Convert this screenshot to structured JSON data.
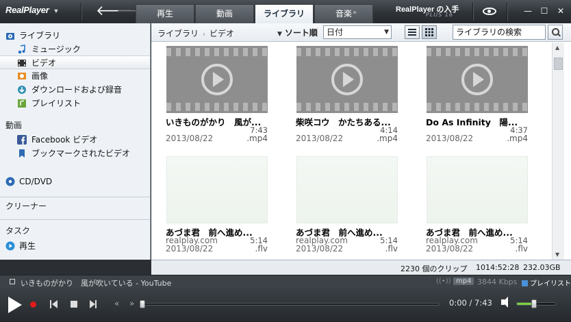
{
  "app": {
    "logo": "RealPlayer",
    "brand": "RealPlayer の入手",
    "brand_sub": "PLUS 16"
  },
  "tabs": [
    {
      "label": "再生"
    },
    {
      "label": "動画"
    },
    {
      "label": "ライブラリ",
      "active": true
    },
    {
      "label": "音楽"
    }
  ],
  "tab_more": "»",
  "sidebar": {
    "library": "ライブラリ",
    "items": [
      {
        "label": "ミュージック"
      },
      {
        "label": "ビデオ",
        "selected": true
      },
      {
        "label": "画像"
      },
      {
        "label": "ダウンロードおよび録音"
      },
      {
        "label": "プレイリスト"
      }
    ],
    "video_head": "動画",
    "video_items": [
      {
        "label": "Facebook ビデオ"
      },
      {
        "label": "ブックマークされたビデオ"
      }
    ],
    "cd_dvd": "CD/DVD",
    "cleaner": "クリーナー",
    "tasks_head": "タスク",
    "tasks": [
      {
        "label": "再生"
      }
    ]
  },
  "toolbar": {
    "breadcrumb_root": "ライブラリ",
    "breadcrumb_current": "ビデオ",
    "sort_label": "ソート順",
    "sort_value": "日付",
    "search_placeholder": "ライブラリの検索"
  },
  "cards": [
    {
      "title": "いきものがかり　風が...",
      "duration": "7:43",
      "date": "2013/08/22",
      "ext": ".mp4",
      "thumb": "video-placeholder"
    },
    {
      "title": "柴咲コウ　かたちある...",
      "duration": "4:14",
      "date": "2013/08/22",
      "ext": ".mp4",
      "thumb": "video-placeholder"
    },
    {
      "title": "Do As Infinity　陽...",
      "duration": "4:37",
      "date": "2013/08/22",
      "ext": ".mp4",
      "thumb": "video-placeholder"
    },
    {
      "title": "あづま君　前へ進め...",
      "source": "realplay.com",
      "duration": "5:14",
      "date": "2013/08/22",
      "ext": ".flv",
      "thumb": "blank"
    },
    {
      "title": "あづま君　前へ進め...",
      "source": "realplay.com",
      "duration": "5:14",
      "date": "2013/08/22",
      "ext": ".flv",
      "thumb": "blank"
    },
    {
      "title": "あづま君　前へ進め...",
      "source": "realplay.com",
      "duration": "5:14",
      "date": "2013/08/22",
      "ext": ".flv",
      "thumb": "blank"
    }
  ],
  "status": {
    "clips": "2230 個のクリップ",
    "total_time": "1014:52:28",
    "size": "232.03GB"
  },
  "now_playing": {
    "title": "いきものがかり　風が吹いている - YouTube",
    "signal": "((•))",
    "format": "mp4",
    "bitrate": "3844 Kbps",
    "playlist_label": "プレイリスト"
  },
  "transport": {
    "time": "0:00 / 7:43",
    "progress_fraction": 0.0,
    "volume_fraction": 0.45
  },
  "colors": {
    "accent_tab": "#ffffff",
    "record": "#e21b1b",
    "volume": "#7bd23b"
  }
}
